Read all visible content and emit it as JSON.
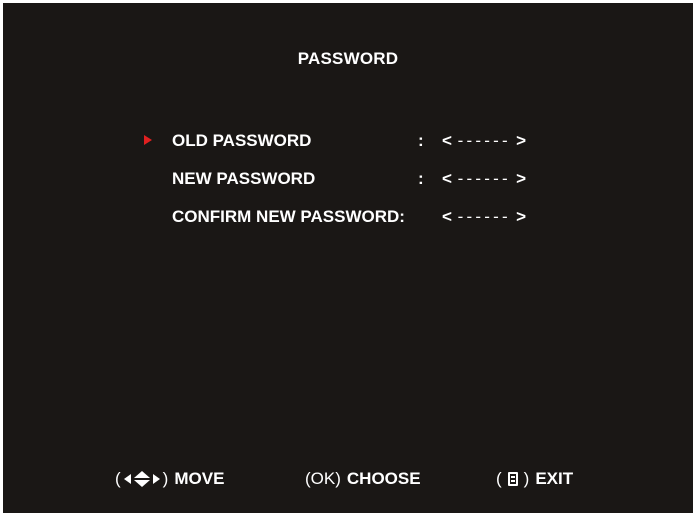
{
  "screen": {
    "title": "PASSWORD",
    "colors": {
      "background": "#1a1715",
      "text": "#ffffff",
      "marker": "#e02020"
    }
  },
  "fields": [
    {
      "label": "OLD PASSWORD",
      "colon": ":",
      "value_open": "<",
      "value_mask": "------",
      "value_close": ">",
      "selected": true
    },
    {
      "label": "NEW PASSWORD",
      "colon": ":",
      "value_open": "<",
      "value_mask": "------",
      "value_close": ">",
      "selected": false
    },
    {
      "label": "CONFIRM NEW PASSWORD:",
      "colon": "",
      "value_open": "<",
      "value_mask": "------",
      "value_close": ">",
      "selected": false
    }
  ],
  "footer": {
    "move": {
      "paren_open": "(",
      "paren_close": ")",
      "label": "MOVE",
      "icons": [
        "arrow-left-icon",
        "arrow-up-down-icon",
        "arrow-right-icon"
      ]
    },
    "choose": {
      "paren_open": "(",
      "key": "OK",
      "paren_close": ")",
      "label": "CHOOSE"
    },
    "exit": {
      "paren_open": "(",
      "paren_close": ")",
      "label": "EXIT",
      "icons": [
        "menu-icon"
      ]
    }
  }
}
